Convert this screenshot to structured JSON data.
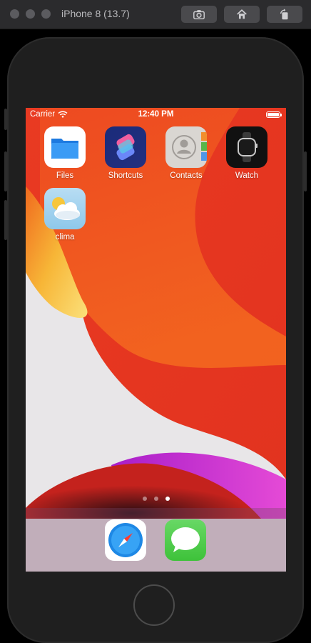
{
  "window": {
    "title": "iPhone 8 (13.7)",
    "toolbar": [
      {
        "name": "screenshot",
        "icon": "camera-icon"
      },
      {
        "name": "home",
        "icon": "home-icon"
      },
      {
        "name": "rotate",
        "icon": "rotate-icon"
      }
    ]
  },
  "status_bar": {
    "carrier": "Carrier",
    "time": "12:40 PM",
    "wifi_icon": "wifi-icon",
    "battery_icon": "battery-icon"
  },
  "apps": [
    {
      "label": "Files",
      "icon": "files-icon"
    },
    {
      "label": "Shortcuts",
      "icon": "shortcuts-icon"
    },
    {
      "label": "Contacts",
      "icon": "contacts-icon"
    },
    {
      "label": "Watch",
      "icon": "watch-icon"
    },
    {
      "label": "clima",
      "icon": "clima-icon"
    }
  ],
  "page_indicator": {
    "count": 3,
    "active_index": 2
  },
  "dock": [
    {
      "name": "Safari",
      "icon": "safari-icon"
    },
    {
      "name": "Messages",
      "icon": "messages-icon"
    }
  ],
  "colors": {
    "wallpaper_red": "#e63a24",
    "wallpaper_orange": "#f2601f",
    "wallpaper_yellow": "#f7c43a",
    "wallpaper_magenta": "#d63ad8",
    "chrome": "#2b2b2d"
  }
}
